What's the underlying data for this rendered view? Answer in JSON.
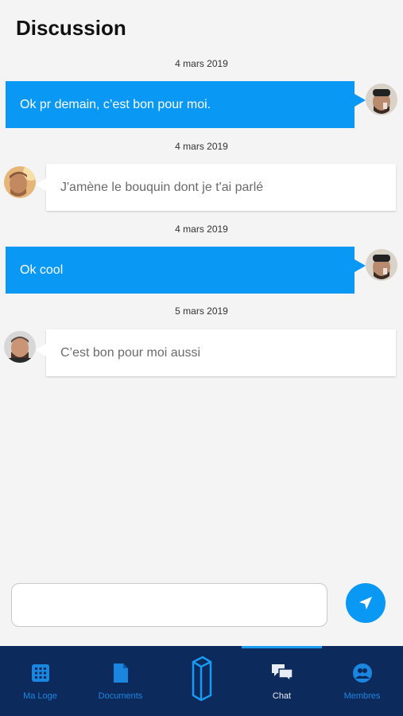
{
  "header": {
    "title": "Discussion"
  },
  "messages": [
    {
      "date": "4 mars 2019",
      "text": "Ok pr demain, c’est bon pour moi.",
      "direction": "out"
    },
    {
      "date": "4 mars 2019",
      "text": "J'amène le bouquin dont je t'ai parlé",
      "direction": "in"
    },
    {
      "date": "4 mars 2019",
      "text": "Ok cool",
      "direction": "out"
    },
    {
      "date": "5 mars 2019",
      "text": "C’est bon pour moi aussi",
      "direction": "in"
    }
  ],
  "composer": {
    "value": "",
    "placeholder": ""
  },
  "tabs": [
    {
      "label": "Ma Loge",
      "icon": "grid-icon"
    },
    {
      "label": "Documents",
      "icon": "document-icon"
    },
    {
      "label": "",
      "icon": "logo-icon"
    },
    {
      "label": "Chat",
      "icon": "chat-icon",
      "active": true
    },
    {
      "label": "Membres",
      "icon": "members-icon"
    }
  ],
  "colors": {
    "accent": "#0a98f5",
    "tabbar": "#0d2a5c",
    "tab_inactive": "#1a86e0"
  }
}
